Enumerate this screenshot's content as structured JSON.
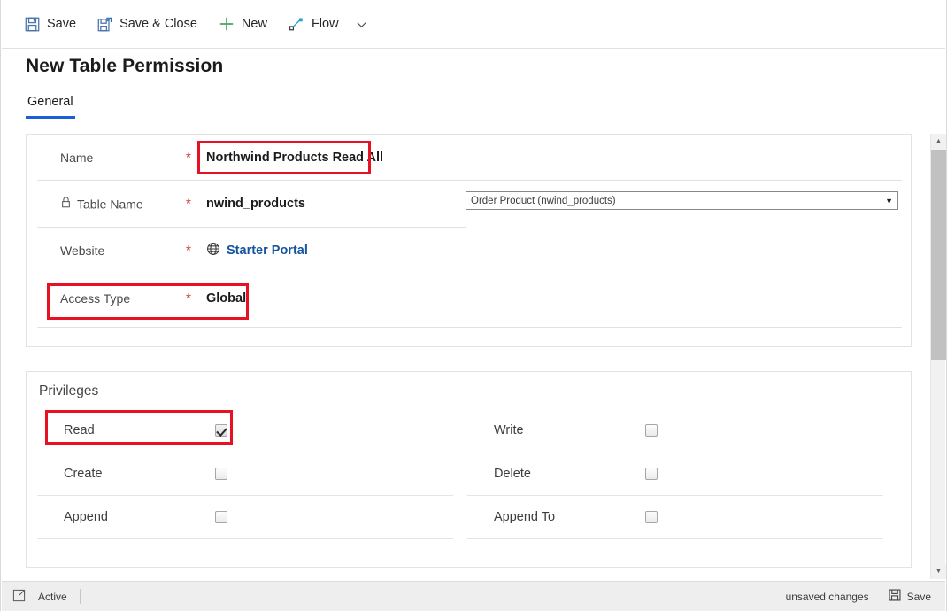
{
  "commandbar": {
    "buttons": [
      {
        "label": "Save",
        "icon": "save-icon"
      },
      {
        "label": "Save & Close",
        "icon": "save-and-close-icon"
      },
      {
        "label": "New",
        "icon": "plus-icon"
      },
      {
        "label": "Flow",
        "icon": "flow-icon"
      }
    ],
    "overflow_caret": "chevron-down-icon"
  },
  "page": {
    "title": "New Table Permission"
  },
  "tabs": [
    {
      "label": "General",
      "active": true
    }
  ],
  "general": {
    "fields": [
      {
        "label": "Name",
        "required": "*",
        "value": "Northwind Products Read All",
        "icon": null,
        "highlighted": true
      },
      {
        "label": "Table Name",
        "required": "*",
        "value": "nwind_products",
        "icon": "lock-icon",
        "highlighted": false
      },
      {
        "label": "Website",
        "required": "*",
        "value": "Starter Portal",
        "icon": "globe-icon",
        "is_link": true,
        "highlighted": false
      },
      {
        "label": "Access Type",
        "required": "*",
        "value": "Global",
        "icon": null,
        "highlighted": true
      }
    ],
    "lookup": {
      "value": "Order Product (nwind_products)",
      "caret": "▼"
    }
  },
  "privileges": {
    "title": "Privileges",
    "left_column": [
      {
        "label": "Read",
        "checked": true,
        "highlighted": true
      },
      {
        "label": "Create",
        "checked": false,
        "highlighted": false
      },
      {
        "label": "Append",
        "checked": false,
        "highlighted": false
      }
    ],
    "right_column": [
      {
        "label": "Write",
        "checked": false
      },
      {
        "label": "Delete",
        "checked": false
      },
      {
        "label": "Append To",
        "checked": false
      }
    ]
  },
  "statusbar": {
    "popout_icon": "popout-icon",
    "status": "Active",
    "unsaved": "unsaved changes",
    "save_label": "Save",
    "save_icon": "save-icon"
  },
  "colors": {
    "accent": "#1a5fd6",
    "link": "#15549e",
    "required": "#d13438",
    "highlight": "#e81123"
  }
}
